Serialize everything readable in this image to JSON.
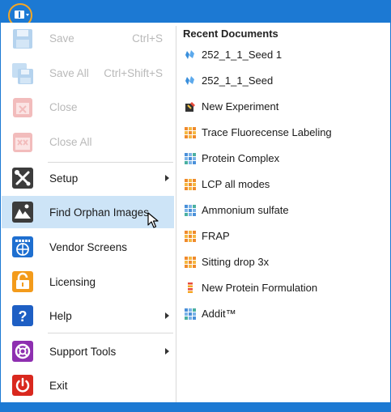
{
  "colors": {
    "accent": "#1c79d3",
    "highlight": "#cde4f7",
    "orange_ring": "#f5a623"
  },
  "app_button": {
    "icon": "book-icon"
  },
  "menu": {
    "save": {
      "label": "Save",
      "shortcut": "Ctrl+S"
    },
    "save_all": {
      "label": "Save All",
      "shortcut": "Ctrl+Shift+S"
    },
    "close": {
      "label": "Close"
    },
    "close_all": {
      "label": "Close All"
    },
    "setup": {
      "label": "Setup"
    },
    "find_orphan": {
      "label": "Find Orphan Images"
    },
    "vendor": {
      "label": "Vendor Screens"
    },
    "licensing": {
      "label": "Licensing"
    },
    "help": {
      "label": "Help"
    },
    "support": {
      "label": "Support Tools"
    },
    "exit": {
      "label": "Exit"
    }
  },
  "recent": {
    "title": "Recent Documents",
    "items": [
      {
        "label": "252_1_1_Seed 1",
        "icon": "crystal-icon"
      },
      {
        "label": "252_1_1_Seed",
        "icon": "crystal-icon"
      },
      {
        "label": "New Experiment",
        "icon": "experiment-icon"
      },
      {
        "label": "Trace Fluorecense Labeling",
        "icon": "plate-orange-icon"
      },
      {
        "label": "Protein Complex",
        "icon": "plate-blue-icon"
      },
      {
        "label": "LCP all modes",
        "icon": "plate-orange-icon"
      },
      {
        "label": "Ammonium sulfate",
        "icon": "plate-blue-icon"
      },
      {
        "label": "FRAP",
        "icon": "plate-orange-icon"
      },
      {
        "label": "Sitting drop 3x",
        "icon": "plate-orange-icon"
      },
      {
        "label": "New Protein Formulation",
        "icon": "formulation-icon"
      },
      {
        "label": "Addit™",
        "icon": "plate-blue-icon"
      }
    ]
  }
}
